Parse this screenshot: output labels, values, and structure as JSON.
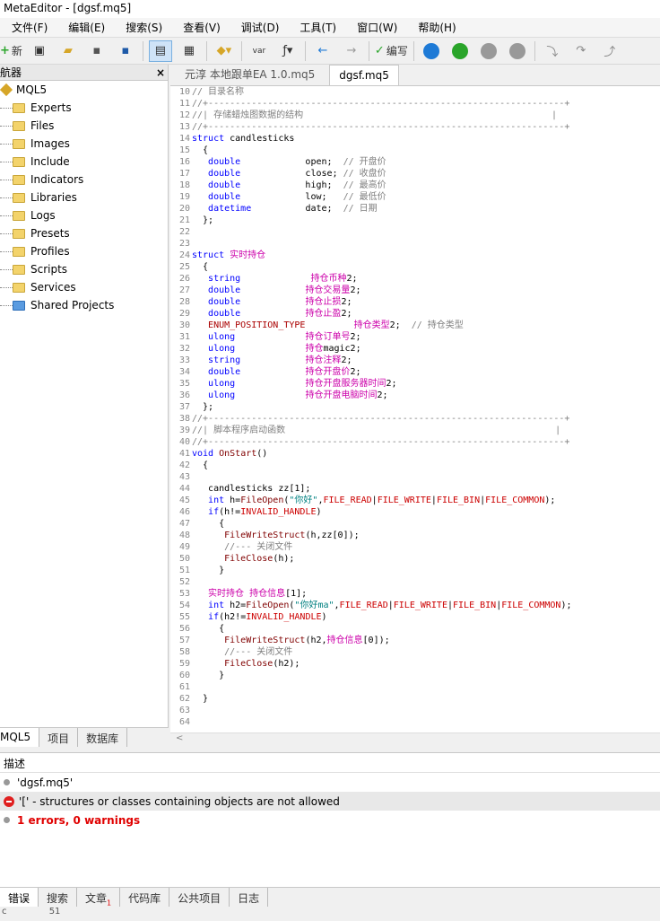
{
  "app": {
    "title": "MetaEditor - [dgsf.mq5]"
  },
  "menu": [
    "文件(F)",
    "编辑(E)",
    "搜索(S)",
    "查看(V)",
    "调试(D)",
    "工具(T)",
    "窗口(W)",
    "帮助(H)"
  ],
  "toolbar": {
    "new_label": "新",
    "compile_label": "编写",
    "var_label": "var",
    "colors": {
      "play": "#2aa52a",
      "stop": "#888888",
      "debug": "#1e7ad6"
    }
  },
  "navigator": {
    "title": "航器",
    "close": "×",
    "root": "MQL5",
    "items": [
      "Experts",
      "Files",
      "Images",
      "Include",
      "Indicators",
      "Libraries",
      "Logs",
      "Presets",
      "Profiles",
      "Scripts",
      "Services",
      "Shared Projects"
    ],
    "tabs": [
      "MQL5",
      "项目",
      "数据库"
    ]
  },
  "editor": {
    "tabs": [
      "元淳 本地跟单EA 1.0.mq5",
      "dgsf.mq5"
    ],
    "lines": [
      {
        "n": "10",
        "segs": [
          {
            "c": "cm",
            "t": "// 目录名称"
          }
        ]
      },
      {
        "n": "11",
        "segs": [
          {
            "c": "cm",
            "t": "//+------------------------------------------------------------------+"
          }
        ]
      },
      {
        "n": "12",
        "segs": [
          {
            "c": "cm",
            "t": "//| 存储蜡烛图数据的结构                                              |"
          }
        ]
      },
      {
        "n": "13",
        "segs": [
          {
            "c": "cm",
            "t": "//+------------------------------------------------------------------+"
          }
        ]
      },
      {
        "n": "14",
        "segs": [
          {
            "c": "kw",
            "t": "struct"
          },
          {
            "c": "",
            "t": " candlesticks"
          }
        ]
      },
      {
        "n": "15",
        "segs": [
          {
            "c": "",
            "t": "  {"
          }
        ]
      },
      {
        "n": "16",
        "segs": [
          {
            "c": "kw",
            "t": "   double"
          },
          {
            "c": "",
            "t": "            open;  "
          },
          {
            "c": "cm",
            "t": "// 开盘价"
          }
        ]
      },
      {
        "n": "17",
        "segs": [
          {
            "c": "kw",
            "t": "   double"
          },
          {
            "c": "",
            "t": "            close; "
          },
          {
            "c": "cm",
            "t": "// 收盘价"
          }
        ]
      },
      {
        "n": "18",
        "segs": [
          {
            "c": "kw",
            "t": "   double"
          },
          {
            "c": "",
            "t": "            high;  "
          },
          {
            "c": "cm",
            "t": "// 最高价"
          }
        ]
      },
      {
        "n": "19",
        "segs": [
          {
            "c": "kw",
            "t": "   double"
          },
          {
            "c": "",
            "t": "            low;   "
          },
          {
            "c": "cm",
            "t": "// 最低价"
          }
        ]
      },
      {
        "n": "20",
        "segs": [
          {
            "c": "kw",
            "t": "   datetime"
          },
          {
            "c": "",
            "t": "          date;  "
          },
          {
            "c": "cm",
            "t": "// 日期"
          }
        ]
      },
      {
        "n": "21",
        "segs": [
          {
            "c": "",
            "t": "  };"
          }
        ]
      },
      {
        "n": "22",
        "segs": [
          {
            "c": "",
            "t": ""
          }
        ]
      },
      {
        "n": "23",
        "segs": [
          {
            "c": "",
            "t": ""
          }
        ]
      },
      {
        "n": "24",
        "segs": [
          {
            "c": "kw",
            "t": "struct"
          },
          {
            "c": "",
            "t": " "
          },
          {
            "c": "cj",
            "t": "实时持仓"
          }
        ]
      },
      {
        "n": "25",
        "segs": [
          {
            "c": "",
            "t": "  {"
          }
        ]
      },
      {
        "n": "26",
        "segs": [
          {
            "c": "kw",
            "t": "   string"
          },
          {
            "c": "",
            "t": "             "
          },
          {
            "c": "cj",
            "t": "持仓币种"
          },
          {
            "c": "",
            "t": "2;"
          }
        ]
      },
      {
        "n": "27",
        "segs": [
          {
            "c": "kw",
            "t": "   double"
          },
          {
            "c": "",
            "t": "            "
          },
          {
            "c": "cj",
            "t": "持仓交易量"
          },
          {
            "c": "",
            "t": "2;"
          }
        ]
      },
      {
        "n": "28",
        "segs": [
          {
            "c": "kw",
            "t": "   double"
          },
          {
            "c": "",
            "t": "            "
          },
          {
            "c": "cj",
            "t": "持仓止损"
          },
          {
            "c": "",
            "t": "2;"
          }
        ]
      },
      {
        "n": "29",
        "segs": [
          {
            "c": "kw",
            "t": "   double"
          },
          {
            "c": "",
            "t": "            "
          },
          {
            "c": "cj",
            "t": "持仓止盈"
          },
          {
            "c": "",
            "t": "2;"
          }
        ]
      },
      {
        "n": "30",
        "segs": [
          {
            "c": "en",
            "t": "   ENUM_POSITION_TYPE"
          },
          {
            "c": "",
            "t": "         "
          },
          {
            "c": "cj",
            "t": "持仓类型"
          },
          {
            "c": "",
            "t": "2;  "
          },
          {
            "c": "cm",
            "t": "// 持仓类型"
          }
        ]
      },
      {
        "n": "31",
        "segs": [
          {
            "c": "kw",
            "t": "   ulong"
          },
          {
            "c": "",
            "t": "             "
          },
          {
            "c": "cj",
            "t": "持仓订单号"
          },
          {
            "c": "",
            "t": "2;"
          }
        ]
      },
      {
        "n": "32",
        "segs": [
          {
            "c": "kw",
            "t": "   ulong"
          },
          {
            "c": "",
            "t": "             "
          },
          {
            "c": "cj",
            "t": "持仓"
          },
          {
            "c": "",
            "t": "magic2;"
          }
        ]
      },
      {
        "n": "33",
        "segs": [
          {
            "c": "kw",
            "t": "   string"
          },
          {
            "c": "",
            "t": "            "
          },
          {
            "c": "cj",
            "t": "持仓注释"
          },
          {
            "c": "",
            "t": "2;"
          }
        ]
      },
      {
        "n": "34",
        "segs": [
          {
            "c": "kw",
            "t": "   double"
          },
          {
            "c": "",
            "t": "            "
          },
          {
            "c": "cj",
            "t": "持仓开盘价"
          },
          {
            "c": "",
            "t": "2;"
          }
        ]
      },
      {
        "n": "35",
        "segs": [
          {
            "c": "kw",
            "t": "   ulong"
          },
          {
            "c": "",
            "t": "             "
          },
          {
            "c": "cj",
            "t": "持仓开盘服务器时间"
          },
          {
            "c": "",
            "t": "2;"
          }
        ]
      },
      {
        "n": "36",
        "segs": [
          {
            "c": "kw",
            "t": "   ulong"
          },
          {
            "c": "",
            "t": "             "
          },
          {
            "c": "cj",
            "t": "持仓开盘电脑时间"
          },
          {
            "c": "",
            "t": "2;"
          }
        ]
      },
      {
        "n": "37",
        "segs": [
          {
            "c": "",
            "t": "  };"
          }
        ]
      },
      {
        "n": "38",
        "segs": [
          {
            "c": "cm",
            "t": "//+------------------------------------------------------------------+"
          }
        ]
      },
      {
        "n": "39",
        "segs": [
          {
            "c": "cm",
            "t": "//| 脚本程序启动函数                                                  |"
          }
        ]
      },
      {
        "n": "40",
        "segs": [
          {
            "c": "cm",
            "t": "//+------------------------------------------------------------------+"
          }
        ]
      },
      {
        "n": "41",
        "segs": [
          {
            "c": "kw",
            "t": "void"
          },
          {
            "c": "",
            "t": " "
          },
          {
            "c": "fn",
            "t": "OnStart"
          },
          {
            "c": "",
            "t": "()"
          }
        ]
      },
      {
        "n": "42",
        "segs": [
          {
            "c": "",
            "t": "  {"
          }
        ]
      },
      {
        "n": "43",
        "segs": [
          {
            "c": "",
            "t": ""
          }
        ]
      },
      {
        "n": "44",
        "segs": [
          {
            "c": "",
            "t": "   candlesticks zz[1];"
          }
        ]
      },
      {
        "n": "45",
        "segs": [
          {
            "c": "kw",
            "t": "   int"
          },
          {
            "c": "",
            "t": " h="
          },
          {
            "c": "fn",
            "t": "FileOpen"
          },
          {
            "c": "",
            "t": "("
          },
          {
            "c": "st",
            "t": "\"你好\""
          },
          {
            "c": "",
            "t": ","
          },
          {
            "c": "cn",
            "t": "FILE_READ"
          },
          {
            "c": "",
            "t": "|"
          },
          {
            "c": "cn",
            "t": "FILE_WRITE"
          },
          {
            "c": "",
            "t": "|"
          },
          {
            "c": "cn",
            "t": "FILE_BIN"
          },
          {
            "c": "",
            "t": "|"
          },
          {
            "c": "cn",
            "t": "FILE_COMMON"
          },
          {
            "c": "",
            "t": ");"
          }
        ]
      },
      {
        "n": "46",
        "segs": [
          {
            "c": "kw",
            "t": "   if"
          },
          {
            "c": "",
            "t": "(h!="
          },
          {
            "c": "cn",
            "t": "INVALID_HANDLE"
          },
          {
            "c": "",
            "t": ")"
          }
        ]
      },
      {
        "n": "47",
        "segs": [
          {
            "c": "",
            "t": "     {"
          }
        ]
      },
      {
        "n": "48",
        "segs": [
          {
            "c": "fn",
            "t": "      FileWriteStruct"
          },
          {
            "c": "",
            "t": "(h,zz[0]);"
          }
        ]
      },
      {
        "n": "49",
        "segs": [
          {
            "c": "cm",
            "t": "      //--- 关闭文件"
          }
        ]
      },
      {
        "n": "50",
        "segs": [
          {
            "c": "fn",
            "t": "      FileClose"
          },
          {
            "c": "",
            "t": "(h);"
          }
        ]
      },
      {
        "n": "51",
        "segs": [
          {
            "c": "",
            "t": "     }"
          }
        ]
      },
      {
        "n": "52",
        "segs": [
          {
            "c": "",
            "t": ""
          }
        ]
      },
      {
        "n": "53",
        "segs": [
          {
            "c": "cj",
            "t": "   实时持仓"
          },
          {
            "c": "",
            "t": " "
          },
          {
            "c": "cj",
            "t": "持仓信息"
          },
          {
            "c": "",
            "t": "[1];"
          }
        ]
      },
      {
        "n": "54",
        "segs": [
          {
            "c": "kw",
            "t": "   int"
          },
          {
            "c": "",
            "t": " h2="
          },
          {
            "c": "fn",
            "t": "FileOpen"
          },
          {
            "c": "",
            "t": "("
          },
          {
            "c": "st",
            "t": "\"你好ma\""
          },
          {
            "c": "",
            "t": ","
          },
          {
            "c": "cn",
            "t": "FILE_READ"
          },
          {
            "c": "",
            "t": "|"
          },
          {
            "c": "cn",
            "t": "FILE_WRITE"
          },
          {
            "c": "",
            "t": "|"
          },
          {
            "c": "cn",
            "t": "FILE_BIN"
          },
          {
            "c": "",
            "t": "|"
          },
          {
            "c": "cn",
            "t": "FILE_COMMON"
          },
          {
            "c": "",
            "t": ");"
          }
        ]
      },
      {
        "n": "55",
        "segs": [
          {
            "c": "kw",
            "t": "   if"
          },
          {
            "c": "",
            "t": "(h2!="
          },
          {
            "c": "cn",
            "t": "INVALID_HANDLE"
          },
          {
            "c": "",
            "t": ")"
          }
        ]
      },
      {
        "n": "56",
        "segs": [
          {
            "c": "",
            "t": "     {"
          }
        ]
      },
      {
        "n": "57",
        "segs": [
          {
            "c": "fn",
            "t": "      FileWriteStruct"
          },
          {
            "c": "",
            "t": "(h2,"
          },
          {
            "c": "cj",
            "t": "持仓信息"
          },
          {
            "c": "",
            "t": "[0]);"
          }
        ]
      },
      {
        "n": "58",
        "segs": [
          {
            "c": "cm",
            "t": "      //--- 关闭文件"
          }
        ]
      },
      {
        "n": "59",
        "segs": [
          {
            "c": "fn",
            "t": "      FileClose"
          },
          {
            "c": "",
            "t": "(h2);"
          }
        ]
      },
      {
        "n": "60",
        "segs": [
          {
            "c": "",
            "t": "     }"
          }
        ]
      },
      {
        "n": "61",
        "segs": [
          {
            "c": "",
            "t": ""
          }
        ]
      },
      {
        "n": "62",
        "segs": [
          {
            "c": "",
            "t": "  }"
          }
        ]
      },
      {
        "n": "63",
        "segs": [
          {
            "c": "",
            "t": ""
          }
        ]
      },
      {
        "n": "64",
        "segs": [
          {
            "c": "",
            "t": ""
          }
        ]
      }
    ]
  },
  "output": {
    "header": "描述",
    "rows": [
      "'dgsf.mq5'",
      "'[' - structures or classes containing objects are not allowed",
      "1 errors, 0 warnings"
    ],
    "tabs": [
      "错误",
      "搜索",
      "文章",
      "代码库",
      "公共项目",
      "日志"
    ],
    "article_badge": "1"
  },
  "status": {
    "left": "c",
    "right": "51"
  }
}
